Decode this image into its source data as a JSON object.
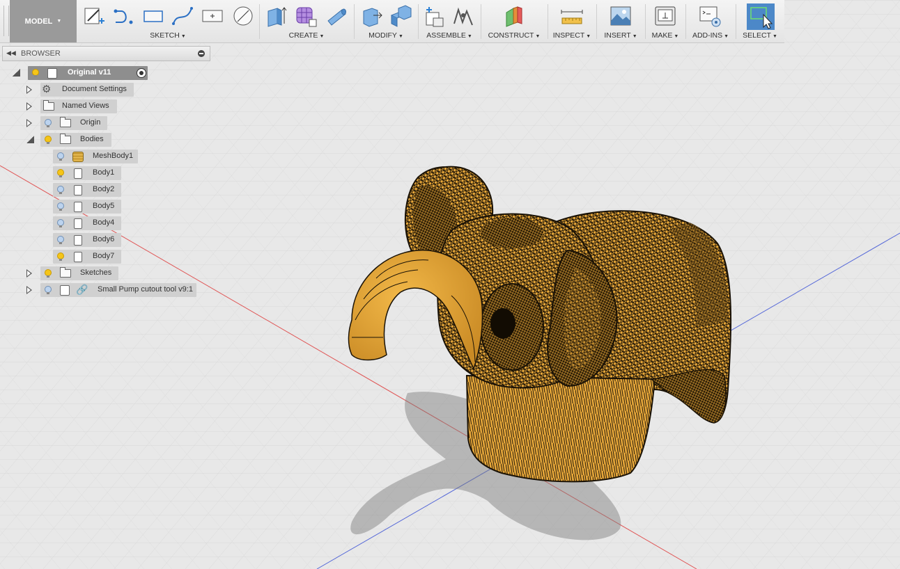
{
  "toolbar": {
    "workspace": "MODEL",
    "groups": {
      "sketch": "SKETCH",
      "create": "CREATE",
      "modify": "MODIFY",
      "assemble": "ASSEMBLE",
      "construct": "CONSTRUCT",
      "inspect": "INSPECT",
      "insert": "INSERT",
      "make": "MAKE",
      "addins": "ADD-INS",
      "select": "SELECT"
    }
  },
  "browser": {
    "title": "BROWSER",
    "root": "Original v11",
    "items": {
      "document_settings": "Document Settings",
      "named_views": "Named Views",
      "origin": "Origin",
      "bodies": "Bodies",
      "sketches": "Sketches",
      "linked_component": "Small Pump cutout tool v9:1"
    },
    "bodies": [
      "MeshBody1",
      "Body1",
      "Body2",
      "Body5",
      "Body4",
      "Body6",
      "Body7"
    ]
  },
  "colors": {
    "model_fill": "#e8a83a",
    "mesh_dark": "#1a1206",
    "grid": "#d2d2d2",
    "axis_x": "#e05555",
    "axis_z": "#5568d8",
    "select_accent": "#4c88c8"
  }
}
